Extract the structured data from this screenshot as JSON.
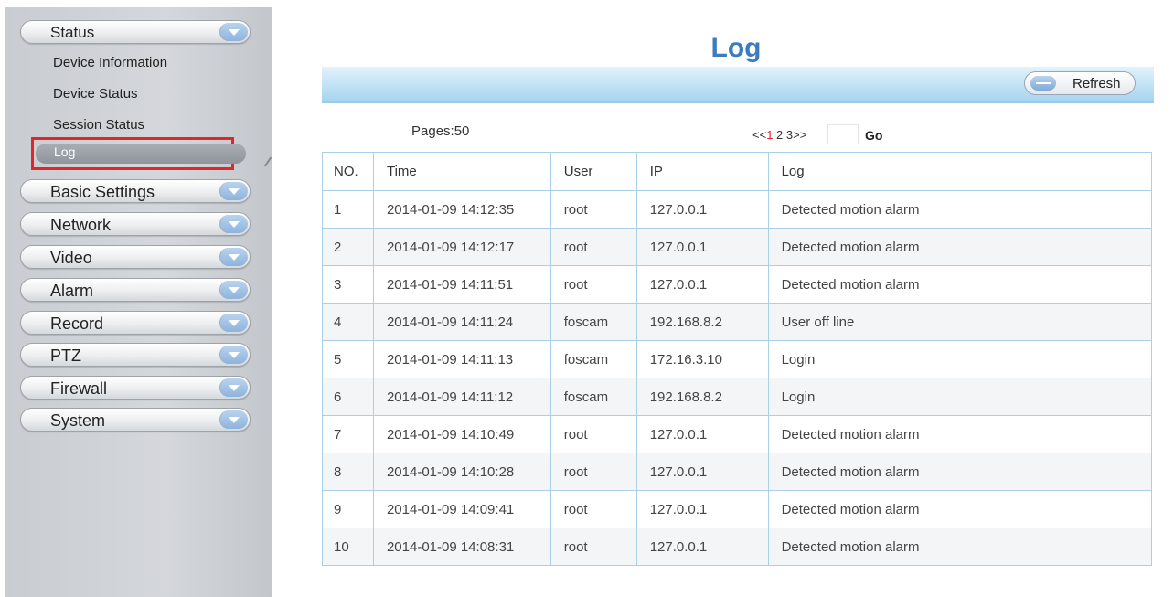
{
  "sidebar": {
    "status": "Status",
    "sub_items": [
      "Device Information",
      "Device Status",
      "Session Status"
    ],
    "active_sub": "Log",
    "sections": [
      "Basic Settings",
      "Network",
      "Video",
      "Alarm",
      "Record",
      "PTZ",
      "Firewall",
      "System"
    ]
  },
  "main": {
    "title": "Log",
    "refresh_label": "Refresh",
    "pages_label": "Pages:50",
    "pager": {
      "prev": "<<",
      "pages": [
        "1",
        "2",
        "3"
      ],
      "next": ">>",
      "current": "1"
    },
    "go_input_value": "",
    "go_label": "Go",
    "table": {
      "headers": [
        "NO.",
        "Time",
        "User",
        "IP",
        "Log"
      ],
      "rows": [
        [
          "1",
          "2014-01-09 14:12:35",
          "root",
          "127.0.0.1",
          "Detected motion alarm"
        ],
        [
          "2",
          "2014-01-09 14:12:17",
          "root",
          "127.0.0.1",
          "Detected motion alarm"
        ],
        [
          "3",
          "2014-01-09 14:11:51",
          "root",
          "127.0.0.1",
          "Detected motion alarm"
        ],
        [
          "4",
          "2014-01-09 14:11:24",
          "foscam",
          "192.168.8.2",
          "User off line"
        ],
        [
          "5",
          "2014-01-09 14:11:13",
          "foscam",
          "172.16.3.10",
          "Login"
        ],
        [
          "6",
          "2014-01-09 14:11:12",
          "foscam",
          "192.168.8.2",
          "Login"
        ],
        [
          "7",
          "2014-01-09 14:10:49",
          "root",
          "127.0.0.1",
          "Detected motion alarm"
        ],
        [
          "8",
          "2014-01-09 14:10:28",
          "root",
          "127.0.0.1",
          "Detected motion alarm"
        ],
        [
          "9",
          "2014-01-09 14:09:41",
          "root",
          "127.0.0.1",
          "Detected motion alarm"
        ],
        [
          "10",
          "2014-01-09 14:08:31",
          "root",
          "127.0.0.1",
          "Detected motion alarm"
        ]
      ]
    }
  },
  "colors": {
    "accent": "#3d7bbf",
    "highlight": "#e0252b",
    "toolbar": "#a6d4ef",
    "grid": "#a9d0e6"
  }
}
